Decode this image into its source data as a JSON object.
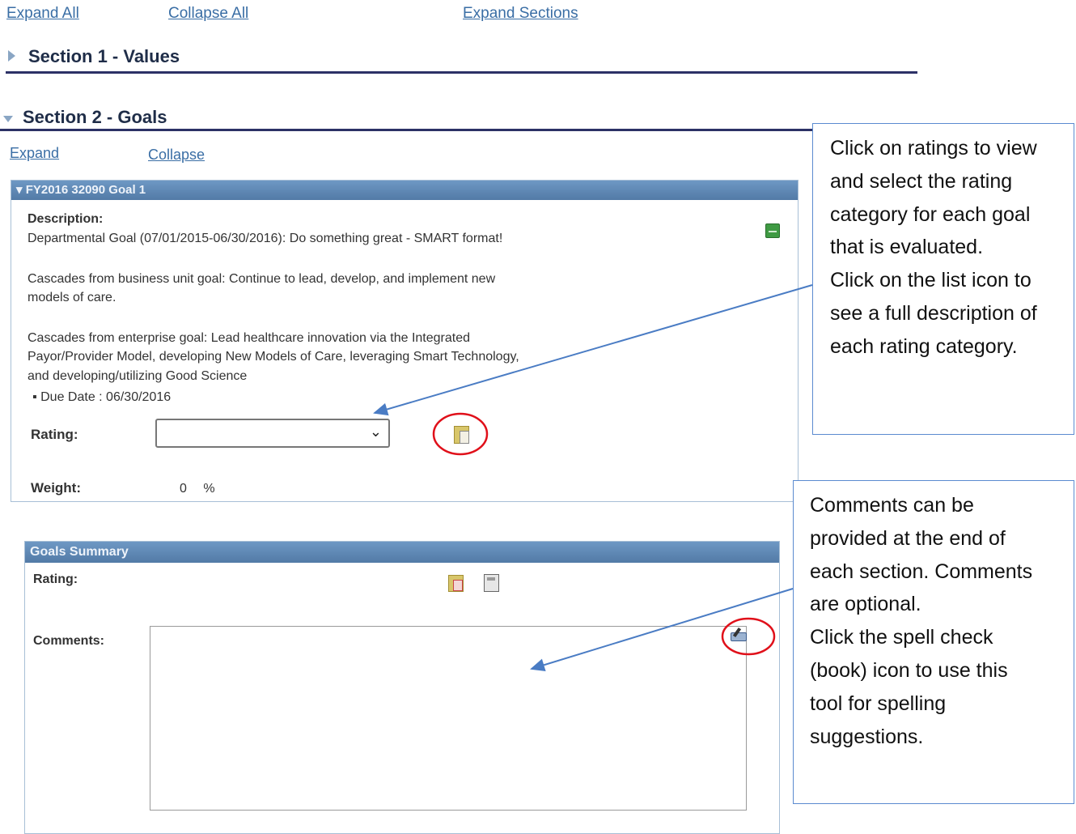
{
  "top_links": {
    "expand_all": "Expand All",
    "collapse_all": "Collapse All",
    "expand_sections": "Expand Sections"
  },
  "section1": {
    "title": "Section 1 - Values"
  },
  "section2": {
    "title": "Section 2 - Goals",
    "expand": "Expand",
    "collapse": "Collapse",
    "goal": {
      "header": "FY2016 32090 Goal 1",
      "description_label": "Description:",
      "description_lines": [
        "Departmental Goal (07/01/2015-06/30/2016): Do something great - SMART format!",
        "Cascades from business unit goal: Continue to lead, develop, and implement new",
        "models of care.",
        "Cascades from enterprise goal: Lead healthcare innovation via the Integrated",
        "Payor/Provider Model, developing New Models of Care, leveraging Smart Technology,",
        "and developing/utilizing Good Science"
      ],
      "due_date": "Due Date : 06/30/2016",
      "rating_label": "Rating:",
      "rating_value": "",
      "weight_label": "Weight:",
      "weight_value": "0",
      "weight_unit": "%"
    }
  },
  "goals_summary": {
    "header": "Goals Summary",
    "rating_label": "Rating:",
    "comments_label": "Comments:"
  },
  "callouts": {
    "ratings": [
      "Click on ratings to view",
      "and select the rating",
      "category for each goal",
      "that is evaluated.",
      "Click on the list icon to",
      "see a full description of",
      "each rating category."
    ],
    "comments": [
      "Comments can be",
      "provided at the end of",
      "each section.  Comments",
      "are optional.",
      "Click the spell check",
      "(book) icon to use this",
      "tool for spelling",
      "suggestions."
    ]
  },
  "colors": {
    "link": "#3a6ea5",
    "header_blue": "#5a84b2",
    "section_rule": "#2c3166",
    "highlight_circle": "#e0101a",
    "arrow": "#4a7cc4"
  },
  "icons": [
    "triangle-right-icon",
    "triangle-down-icon",
    "green-note-icon",
    "rating-list-icon",
    "calculator-icon",
    "spell-check-icon"
  ]
}
